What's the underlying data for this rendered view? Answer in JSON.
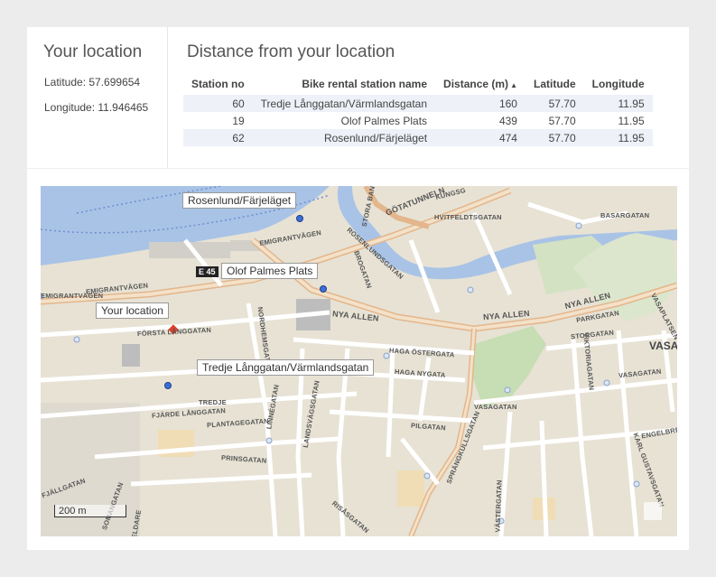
{
  "location": {
    "title": "Your location",
    "latitude": "Latitude: 57.699654",
    "longitude": "Longitude: 11.946465"
  },
  "distance": {
    "title": "Distance from your location",
    "headers": [
      "Station no",
      "Bike rental station name",
      "Distance (m)",
      "Latitude",
      "Longitude"
    ],
    "sort_indicator": "▲",
    "rows": [
      [
        "60",
        "Tredje Långgatan/Värmlandsgatan",
        "160",
        "57.70",
        "11.95"
      ],
      [
        "19",
        "Olof Palmes Plats",
        "439",
        "57.70",
        "11.95"
      ],
      [
        "62",
        "Rosenlund/Färjeläget",
        "474",
        "57.70",
        "11.95"
      ]
    ]
  },
  "map": {
    "labels": {
      "rosenlund": "Rosenlund/Färjeläget",
      "olof": "Olof Palmes Plats",
      "your_location": "Your location",
      "tredje": "Tredje Långgatan/Värmlandsgatan"
    },
    "road_shield": "E 45",
    "scale": "200 m",
    "district": "VASASTA",
    "streets": {
      "emigrant1": "EMIGRANTVÄGEN",
      "emigrant2": "EMIGRANTVÄGEN",
      "emigrant3": "EMIGRANTVÄGEN",
      "forsta": "FÖRSTA LÅNGGATAN",
      "fjarde": "FJÄRDE LÅNGGATAN",
      "nordhem": "NORDHEMSGATAN",
      "nyaallen1": "NYA ALLEN",
      "nyaallen2": "NYA ALLEN",
      "nyaallen3": "NYA ALLEN",
      "parkgatan": "PARKGATAN",
      "storgatan": "STORGATAN",
      "haga_ostra": "HAGA ÖSTERGATA",
      "haga_nygata": "HAGA NYGATA",
      "pilgatan": "PILGATAN",
      "vasagatan": "VASAGATAN",
      "vasagatan2": "VASAGATAN",
      "sprangkull": "SPRÄNGKULLSGATAN",
      "gotatunnel": "GÖTATUNNELN",
      "hvitfeldt": "HVITFELDTSGATAN",
      "basargatan": "BASARGATAN",
      "rosenlundsgatan": "ROSENLUNDSGATAN",
      "brogatan": "BROGATAN",
      "plantage": "PLANTAGEGATAN",
      "prinsgatan": "PRINSGATAN",
      "linnegatan": "LINNÉGATAN",
      "landsvag": "LANDSVÄGSGATAN",
      "risasgatan": "RISÅSGATAN",
      "engelbrekt": "ENGELBREKT",
      "karl_gustav": "KARL GUSTAVSGATAN",
      "vastergatan": "VÄSTERGATAN",
      "viktoria": "VIKTORIAGATAN",
      "kungsgatan": "KUNGSG",
      "vasaplatsen": "VASAPLATSEN",
      "stora": "STORA BAN",
      "fjallgatan": "FJÄLLGATAN",
      "somanugatan": "SOMANGATAN",
      "eldare": "ELDARE",
      "tredjeg": "TREDJE"
    }
  }
}
